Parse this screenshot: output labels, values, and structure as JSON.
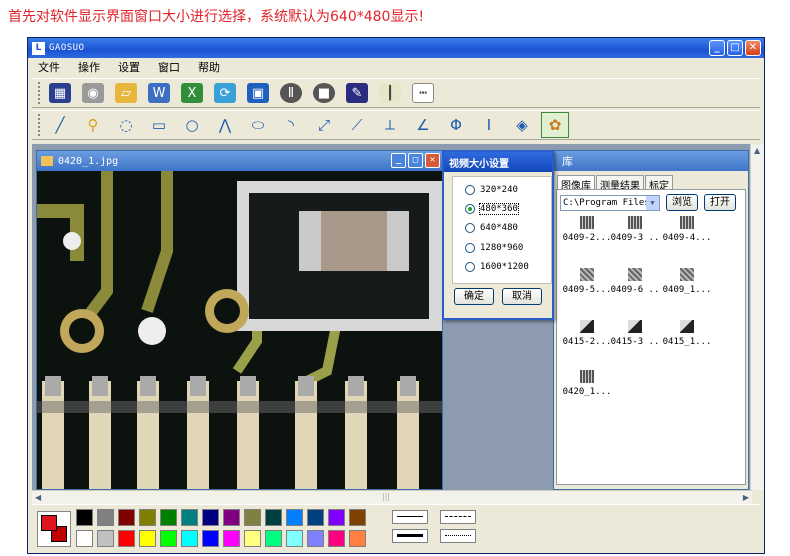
{
  "caption": "首先对软件显示界面窗口大小进行选择，系统默认为640*480显示!",
  "app": {
    "title": "GAOSUO",
    "logo_letter": "L",
    "menu": [
      "文件",
      "操作",
      "设置",
      "窗口",
      "帮助"
    ]
  },
  "toolbar1": [
    "film-icon",
    "camera-icon",
    "folder-open-icon",
    "word-icon",
    "excel-icon",
    "refresh-icon",
    "save-icon",
    "pause-icon",
    "stop-icon",
    "wrench-icon",
    "ruler-vertical-icon",
    "ruler-horizontal-icon"
  ],
  "toolbar2": [
    "line-icon",
    "zoom-icon",
    "lasso-icon",
    "rectangle-icon",
    "circle-icon",
    "polyline-icon",
    "ellipse-icon",
    "arc-icon",
    "measure-line-icon",
    "point-line-icon",
    "perpendicular-icon",
    "angle-icon",
    "horizontal-caliper-icon",
    "vertical-caliper-icon",
    "diamond-caliper-icon",
    "color-palette-icon"
  ],
  "image_window": {
    "title": "0420_1.jpg"
  },
  "dialog": {
    "title": "视频大小设置",
    "options": [
      "320*240",
      "480*360",
      "640*480",
      "1280*960",
      "1600*1200"
    ],
    "selected_index": 1,
    "ok_label": "确定",
    "cancel_label": "取消"
  },
  "library": {
    "title": "库",
    "tabs": [
      "图像库",
      "测量结果",
      "标定"
    ],
    "active_tab": 0,
    "path": "C:\\Program Files",
    "browse_label": "浏览",
    "open_label": "打开",
    "thumbnails": [
      "0409-2...",
      "0409-3 ..",
      "0409-4...",
      "0409-5...",
      "0409-6 ..",
      "0409_1...",
      "0415-2...",
      "0415-3 ..",
      "0415_1...",
      "0420_1..."
    ]
  },
  "palette": {
    "foreground": "#e0141c",
    "background": "#c00000",
    "row1": [
      "#000000",
      "#808080",
      "#800000",
      "#808000",
      "#008000",
      "#008080",
      "#000080",
      "#800080",
      "#808040",
      "#004040",
      "#0080ff",
      "#004080",
      "#8000ff",
      "#804000"
    ],
    "row2": [
      "#ffffff",
      "#c0c0c0",
      "#ff0000",
      "#ffff00",
      "#00ff00",
      "#00ffff",
      "#0000ff",
      "#ff00ff",
      "#ffff80",
      "#00ff80",
      "#80ffff",
      "#8080ff",
      "#ff0080",
      "#ff8040"
    ]
  }
}
